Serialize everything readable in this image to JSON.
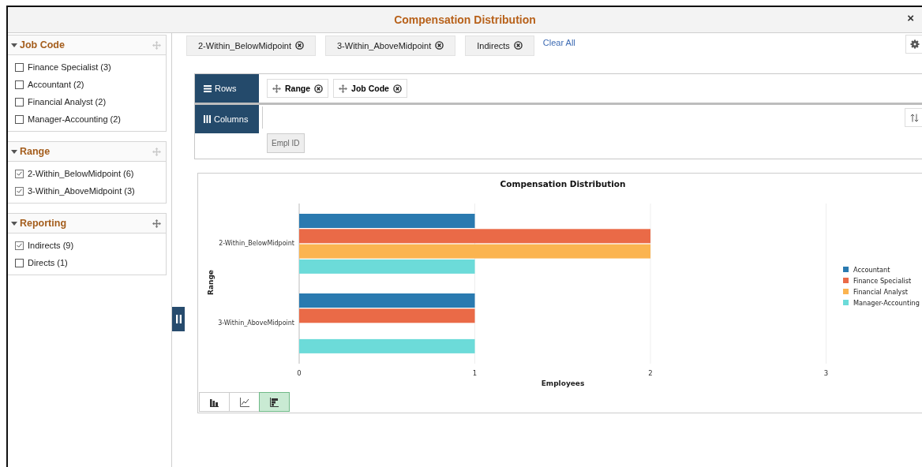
{
  "window": {
    "title": "Compensation Distribution",
    "close": "×"
  },
  "facets": [
    {
      "title": "Job Code",
      "expanded": true,
      "items": [
        {
          "label": "Finance Specialist (3)",
          "checked": false
        },
        {
          "label": "Accountant (2)",
          "checked": false
        },
        {
          "label": "Financial Analyst (2)",
          "checked": false
        },
        {
          "label": "Manager-Accounting (2)",
          "checked": false
        }
      ]
    },
    {
      "title": "Range",
      "expanded": true,
      "items": [
        {
          "label": "2-Within_BelowMidpoint (6)",
          "checked": true
        },
        {
          "label": "3-Within_AboveMidpoint (3)",
          "checked": true
        }
      ]
    },
    {
      "title": "Reporting",
      "expanded": true,
      "items": [
        {
          "label": "Indirects (9)",
          "checked": true
        },
        {
          "label": "Directs (1)",
          "checked": false
        }
      ]
    }
  ],
  "filter_chips": [
    {
      "label": "2-Within_BelowMidpoint"
    },
    {
      "label": "3-Within_AboveMidpoint"
    },
    {
      "label": "Indirects"
    }
  ],
  "clear_all": "Clear All",
  "pivot": {
    "rows_label": "Rows",
    "row_fields": [
      "Range",
      "Job Code"
    ],
    "columns_label": "Columns",
    "available_fields": [
      "Empl ID"
    ]
  },
  "chart": {
    "chart_data": {
      "type": "bar",
      "orientation": "horizontal",
      "title": "Compensation Distribution",
      "xlabel": "Employees",
      "ylabel": "Range",
      "categories": [
        "2-Within_BelowMidpoint",
        "3-Within_AboveMidpoint"
      ],
      "series": [
        {
          "name": "Accountant",
          "color": "#2a7ab0",
          "values": [
            1,
            1
          ]
        },
        {
          "name": "Finance Specialist",
          "color": "#ea6a47",
          "values": [
            2,
            1
          ]
        },
        {
          "name": "Financial Analyst",
          "color": "#fbb450",
          "values": [
            2,
            null
          ]
        },
        {
          "name": "Manager-Accounting",
          "color": "#6cdbd9",
          "values": [
            1,
            1
          ]
        }
      ],
      "xlim": [
        0,
        3
      ],
      "xticks": [
        0,
        1,
        2,
        3
      ],
      "legend": true
    },
    "view_modes": [
      {
        "kind": "column",
        "selected": false
      },
      {
        "kind": "line",
        "selected": false
      },
      {
        "kind": "bar",
        "selected": true
      }
    ]
  }
}
